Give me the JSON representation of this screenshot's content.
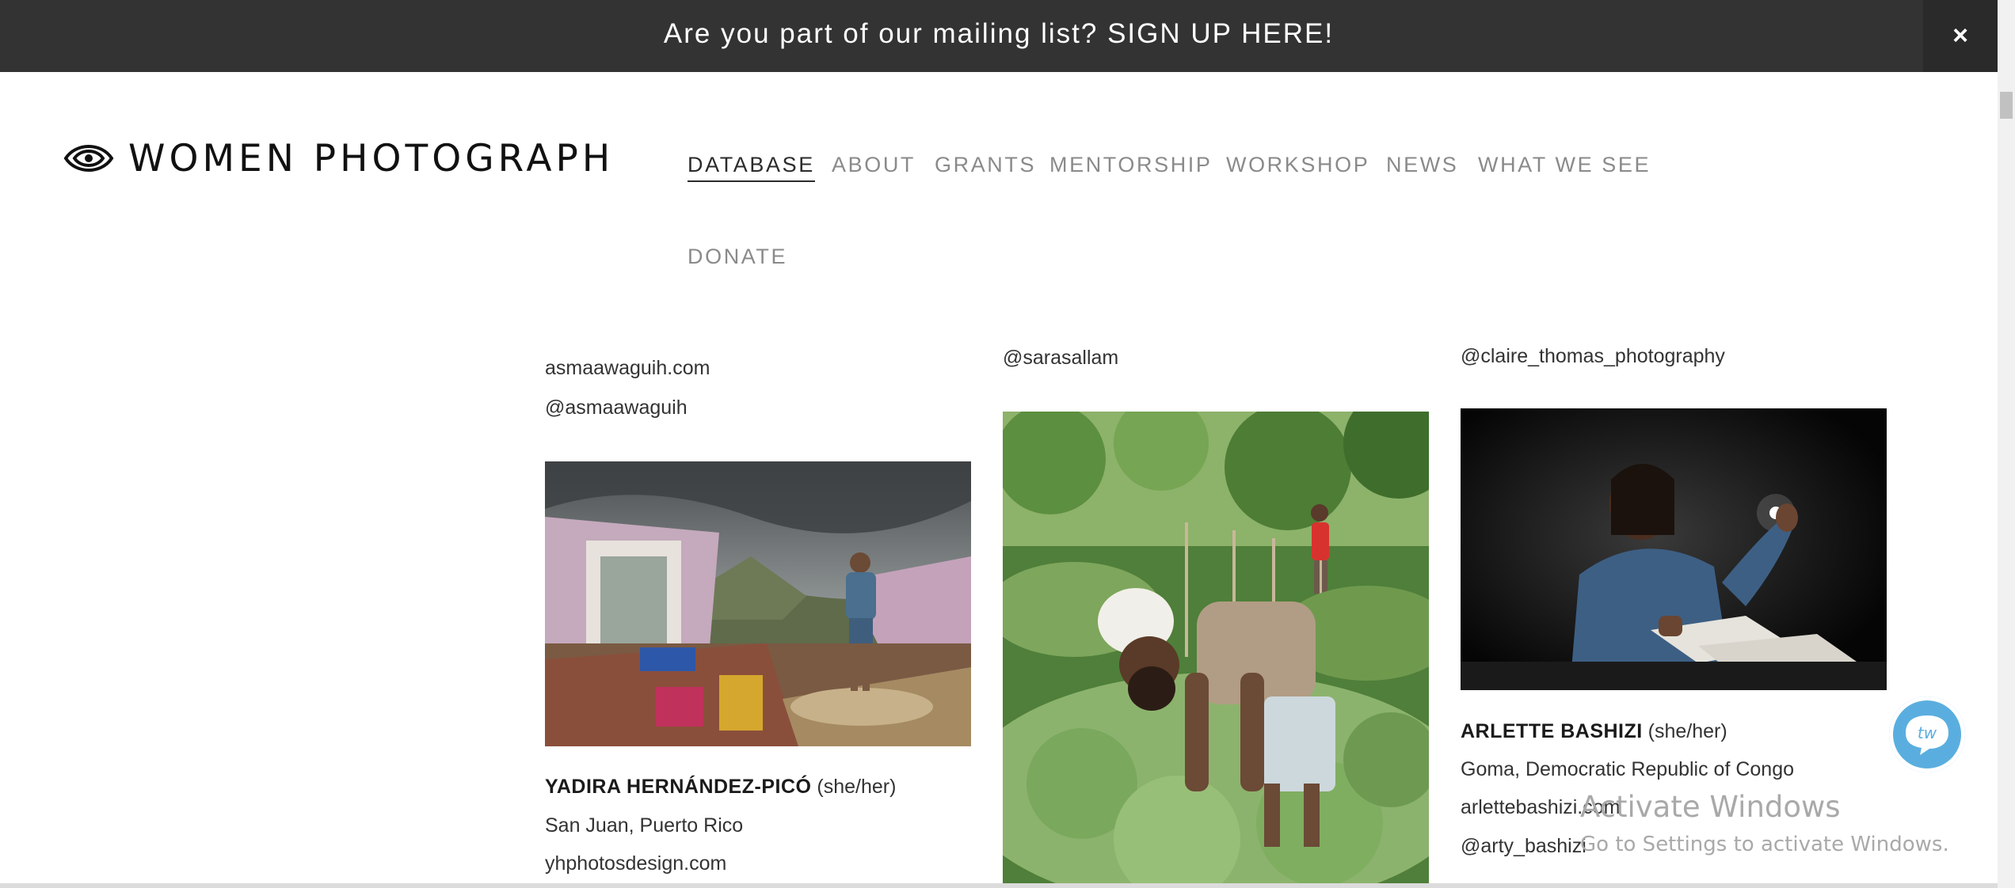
{
  "banner": {
    "text": "Are you part of our mailing list? SIGN UP HERE!",
    "close_label": "×"
  },
  "logo": {
    "text": "WOMEN PHOTOGRAPH",
    "icon": "eye-logo-icon"
  },
  "nav": [
    {
      "label": "DATABASE",
      "active": true
    },
    {
      "label": "ABOUT"
    },
    {
      "label": "GRANTS"
    },
    {
      "label": "MENTORSHIP"
    },
    {
      "label": "WORKSHOP"
    },
    {
      "label": "NEWS"
    },
    {
      "label": "WHAT WE SEE"
    },
    {
      "label": "DONATE"
    }
  ],
  "col1": {
    "top_website": "asmaawaguih.com",
    "top_handle": "@asmaawaguih",
    "photo_alt": "Woman standing in hurricane-destroyed house",
    "name": "YADIRA HERNÁNDEZ-PICÓ",
    "pronouns": "(she/her)",
    "location": "San Juan, Puerto Rico",
    "website": "yhphotosdesign.com"
  },
  "col2": {
    "top_handle": "@sarasallam",
    "photo_alt": "Farmer harvesting kale in a garden"
  },
  "col3": {
    "top_handle": "@claire_thomas_photography",
    "photo_alt": "Girl writing by lamplight in the dark",
    "name": "ARLETTE BASHIZI",
    "pronouns": "(she/her)",
    "location": "Goma, Democratic Republic of Congo",
    "website": "arlettebashizi.com",
    "handle": "@arty_bashizi"
  },
  "chat": {
    "label": "tw"
  },
  "watermark": {
    "title": "Activate Windows",
    "subtitle": "Go to Settings to activate Windows."
  },
  "colors": {
    "banner_bg": "#333333",
    "chat_bg": "#5aaedf",
    "nav_text": "#8a8a8a"
  }
}
